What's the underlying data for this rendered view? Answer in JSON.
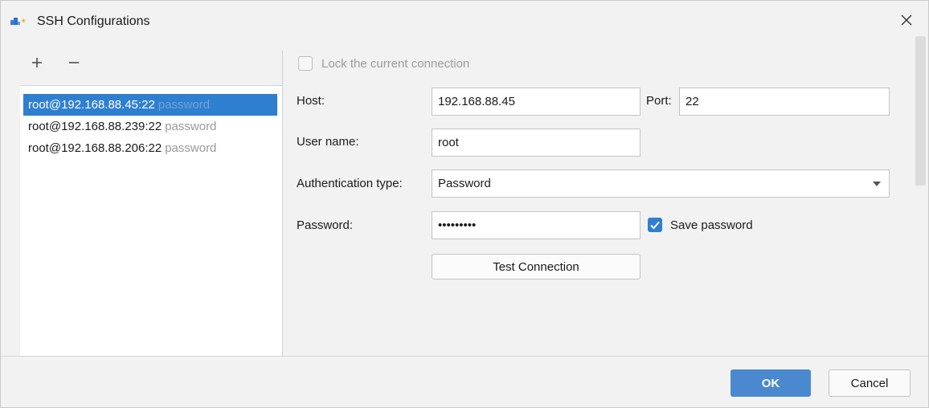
{
  "window": {
    "title": "SSH Configurations",
    "icon": "app-logo-icon",
    "close_icon": "close-icon"
  },
  "left_panel": {
    "add_icon": "plus-icon",
    "remove_icon": "minus-icon",
    "connections": [
      {
        "host": "root@192.168.88.45:22",
        "auth": "password",
        "selected": true
      },
      {
        "host": "root@192.168.88.239:22",
        "auth": "password",
        "selected": false
      },
      {
        "host": "root@192.168.88.206:22",
        "auth": "password",
        "selected": false
      }
    ]
  },
  "form": {
    "lock_label": "Lock the current connection",
    "lock_checked": false,
    "host_label": "Host:",
    "host_value": "192.168.88.45",
    "port_label": "Port:",
    "port_value": "22",
    "username_label": "User name:",
    "username_value": "root",
    "auth_type_label": "Authentication type:",
    "auth_type_value": "Password",
    "password_label": "Password:",
    "password_value": "•••••••••",
    "save_password_label": "Save password",
    "save_password_checked": true,
    "test_button": "Test Connection"
  },
  "footer": {
    "ok_label": "OK",
    "cancel_label": "Cancel"
  },
  "colors": {
    "accent": "#2f7fd0",
    "ok_button": "#4a89cf",
    "background": "#f2f2f2"
  }
}
